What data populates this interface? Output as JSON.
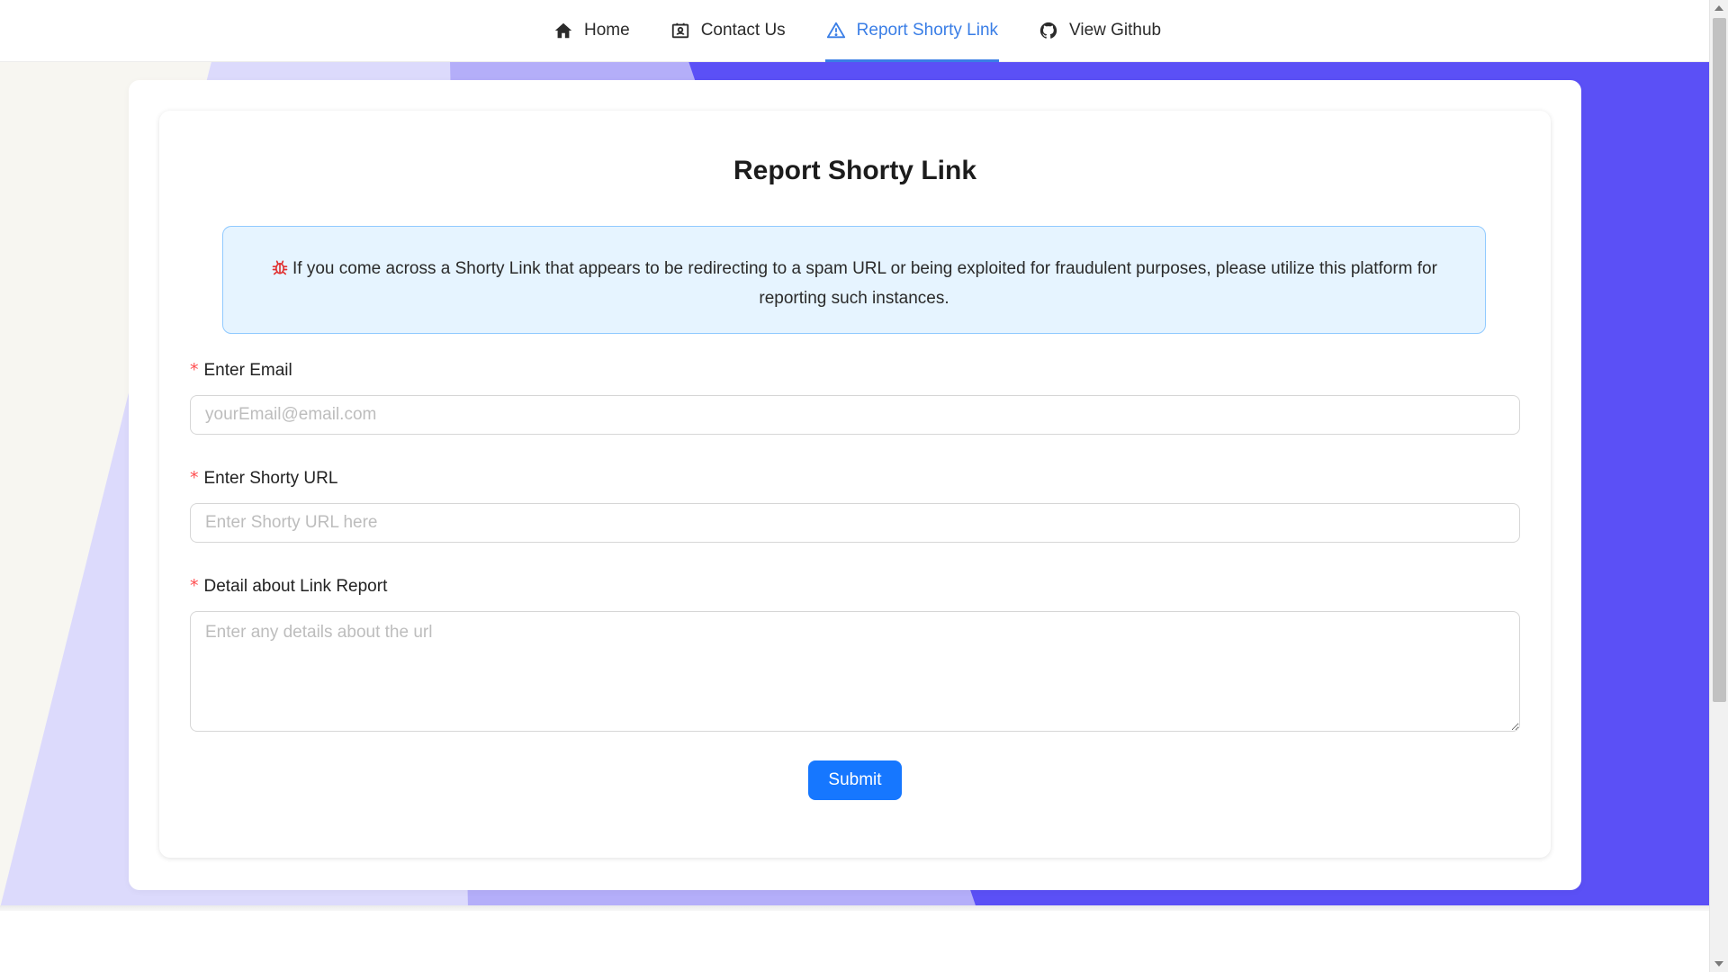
{
  "nav": {
    "items": [
      {
        "label": "Home",
        "icon": "home-icon",
        "active": false
      },
      {
        "label": "Contact Us",
        "icon": "contact-card-icon",
        "active": false
      },
      {
        "label": "Report Shorty Link",
        "icon": "warning-icon",
        "active": true
      },
      {
        "label": "View Github",
        "icon": "github-icon",
        "active": false
      }
    ],
    "active_color": "#3a7ee6"
  },
  "page": {
    "title": "Report Shorty Link",
    "alert_text": "If you come across a Shorty Link that appears to be redirecting to a spam URL or being exploited for fraudulent purposes, please utilize this platform for reporting such instances.",
    "alert_icon": "bug-icon"
  },
  "form": {
    "required_mark": "*",
    "email": {
      "label": "Enter Email",
      "value": "",
      "placeholder": "yourEmail@email.com"
    },
    "url": {
      "label": "Enter Shorty URL",
      "value": "",
      "placeholder": "Enter Shorty URL here"
    },
    "details": {
      "label": "Detail about Link Report",
      "value": "",
      "placeholder": "Enter any details about the url"
    },
    "submit_label": "Submit"
  },
  "colors": {
    "primary": "#1677ff",
    "required": "#ff4d4f",
    "alert_bg": "#e6f4ff",
    "alert_border": "#91caff",
    "background_accent": "#5b50f6"
  }
}
